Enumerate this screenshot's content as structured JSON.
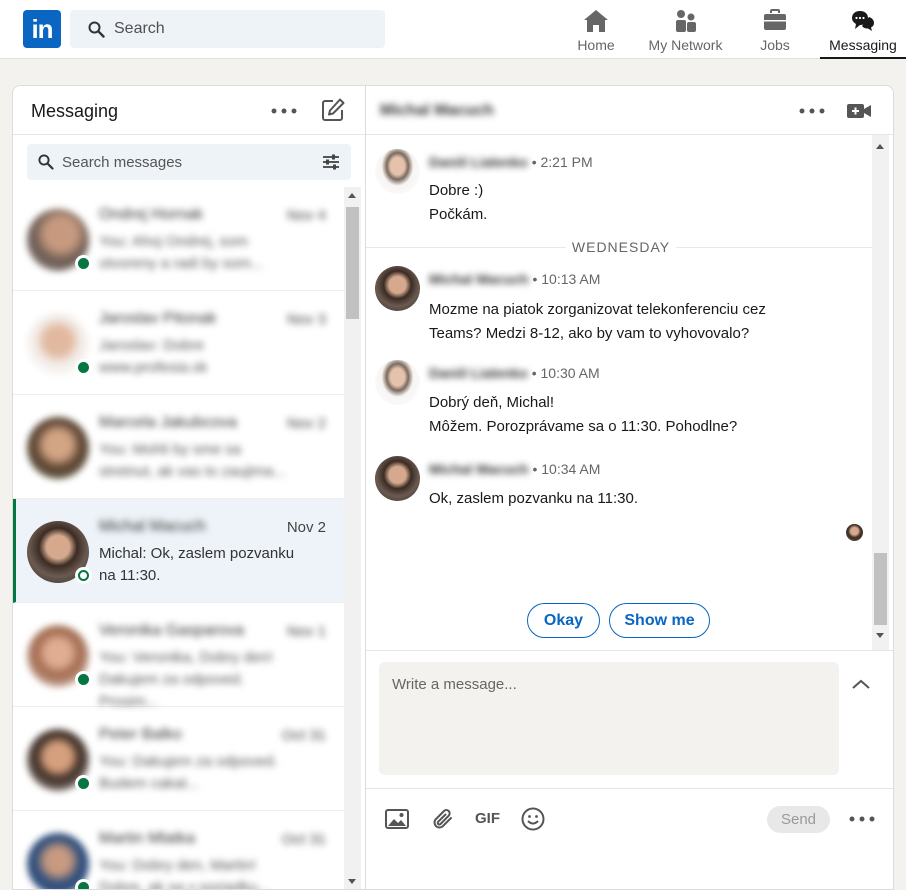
{
  "colors": {
    "brand": "#0a66c2",
    "online": "#057642",
    "active_bg": "#edf3f8"
  },
  "topnav": {
    "logo_text": "in",
    "search_placeholder": "Search",
    "items": [
      {
        "label": "Home",
        "icon": "home-icon"
      },
      {
        "label": "My Network",
        "icon": "people-icon"
      },
      {
        "label": "Jobs",
        "icon": "briefcase-icon"
      },
      {
        "label": "Messaging",
        "icon": "chat-icon",
        "active": true
      }
    ]
  },
  "sidebar": {
    "title": "Messaging",
    "search_placeholder": "Search messages",
    "conversations": [
      {
        "name": "Ondrej Hornak",
        "date": "Nov 4",
        "preview": "You: Ahoj Ondrej, som otvoreny a radi by som...",
        "blurred": true,
        "online": true
      },
      {
        "name": "Jaroslav Pitonak",
        "date": "Nov 3",
        "preview": "Jaroslav: Dobre www.profesia.sk",
        "blurred": true,
        "online": true
      },
      {
        "name": "Marcela Jakubcova",
        "date": "Nov 2",
        "preview": "You: Mohli by sme sa stretnut, ak vas to zaujima...",
        "blurred": true,
        "online": false
      },
      {
        "name": "Michal Macuch",
        "date": "Nov 2",
        "preview": "Michal: Ok, zaslem pozvanku na 11:30.",
        "blurred": true,
        "online": true,
        "active": true
      },
      {
        "name": "Veronika Gasparova",
        "date": "Nov 1",
        "preview": "You: Veronika, Dobry den! Dakujem za odpoved. Prosim...",
        "blurred": true,
        "online": true
      },
      {
        "name": "Peter Balko",
        "date": "Oct 31",
        "preview": "You: Dakujem za odpoved. Budem cakat...",
        "blurred": true,
        "online": true
      },
      {
        "name": "Martin Mlatka",
        "date": "Oct 31",
        "preview": "You: Dobry den, Martin! Dobre, ak sa v poriadku...",
        "blurred": true,
        "online": true
      }
    ]
  },
  "thread": {
    "contact_name": "Michal Macuch",
    "day_label": "WEDNESDAY",
    "messages": [
      {
        "sender": "Daniil Lialenko",
        "time": "• 2:21 PM",
        "lines": [
          "Dobre :)",
          "Počkám."
        ]
      },
      {
        "sender": "Michal Macuch",
        "time": "• 10:13 AM",
        "lines": [
          "Mozme na piatok zorganizovat telekonferenciu cez",
          "Teams? Medzi 8-12, ako by vam to vyhovovalo?"
        ]
      },
      {
        "sender": "Daniil Lialenko",
        "time": "• 10:30 AM",
        "lines": [
          "Dobrý deň, Michal!",
          "Môžem. Porozprávame sa o 11:30. Pohodlne?"
        ]
      },
      {
        "sender": "Michal Macuch",
        "time": "• 10:34 AM",
        "lines": [
          "Ok, zaslem pozvanku na 11:30."
        ]
      }
    ],
    "quick_replies": [
      "Okay",
      "Show me"
    ]
  },
  "composer": {
    "placeholder": "Write a message...",
    "gif_label": "GIF",
    "send_label": "Send"
  }
}
